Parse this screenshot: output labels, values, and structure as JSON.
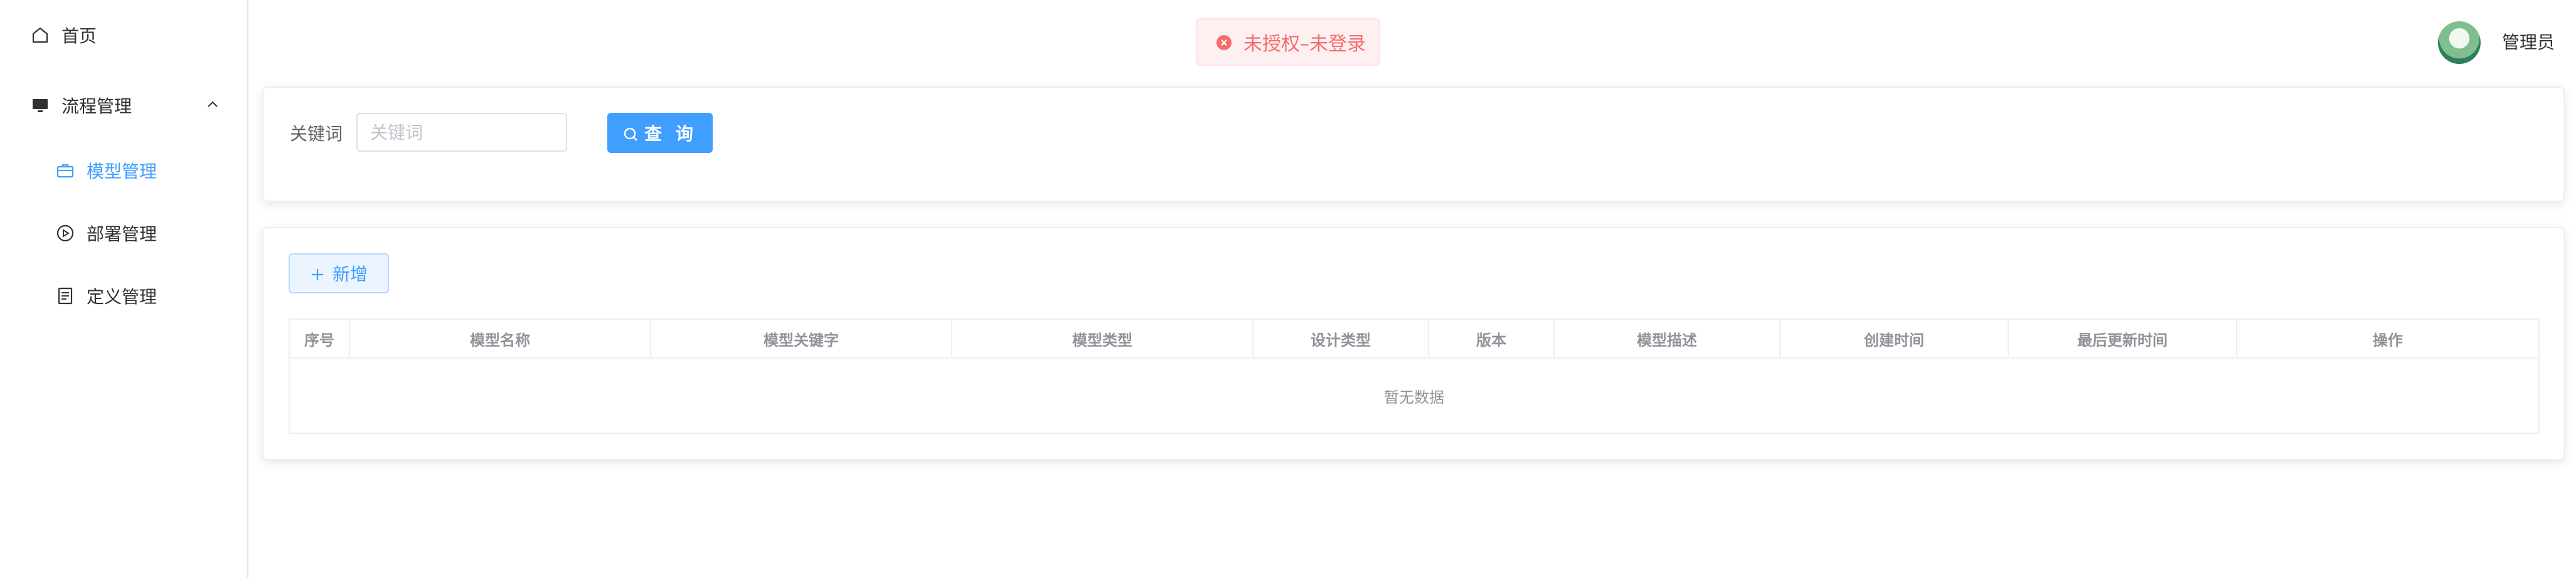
{
  "sidebar": {
    "items": [
      {
        "label": "首页",
        "icon": "home-icon"
      },
      {
        "label": "流程管理",
        "icon": "monitor-icon",
        "expanded": true
      },
      {
        "label": "模型管理",
        "icon": "briefcase-icon",
        "active": true
      },
      {
        "label": "部署管理",
        "icon": "play-circle-icon"
      },
      {
        "label": "定义管理",
        "icon": "document-icon"
      }
    ]
  },
  "header": {
    "toast": {
      "text": "未授权–未登录",
      "icon": "error-circle-icon",
      "color": "#f56c6c"
    },
    "user": {
      "name": "管理员",
      "avatar": "avatar-image"
    }
  },
  "search": {
    "label": "关键词",
    "placeholder": "关键词",
    "value": "",
    "button": "查 询"
  },
  "toolbar": {
    "add_label": "新增"
  },
  "table": {
    "columns": [
      "序号",
      "模型名称",
      "模型关键字",
      "模型类型",
      "设计类型",
      "版本",
      "模型描述",
      "创建时间",
      "最后更新时间",
      "操作"
    ],
    "rows": [],
    "empty_text": "暂无数据"
  },
  "colors": {
    "primary": "#409eff",
    "danger": "#f56c6c",
    "border": "#ebeef5",
    "text": "#303133",
    "muted": "#909399"
  }
}
